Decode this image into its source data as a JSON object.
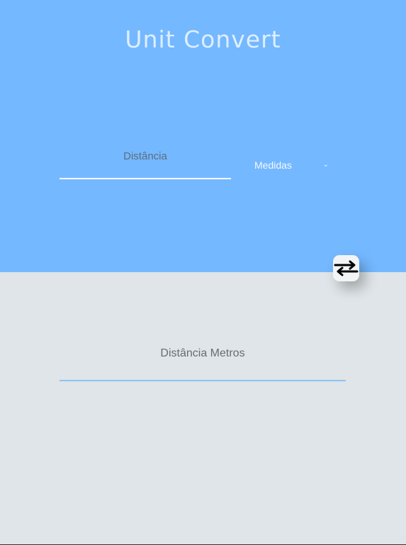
{
  "app": {
    "title": "Unit Convert"
  },
  "input": {
    "placeholder": "Distância",
    "value": ""
  },
  "unit_select": {
    "selected": "Medidas",
    "icon": "chevron-down-icon"
  },
  "swap_button": {
    "icon": "swap-arrows-icon"
  },
  "output": {
    "placeholder": "Distância Metros",
    "value": ""
  },
  "colors": {
    "top_background": "#74b8ff",
    "bottom_background": "#dfe5e8",
    "swap_button_background": "#f2f4f6",
    "output_underline": "#8ec3f5"
  }
}
